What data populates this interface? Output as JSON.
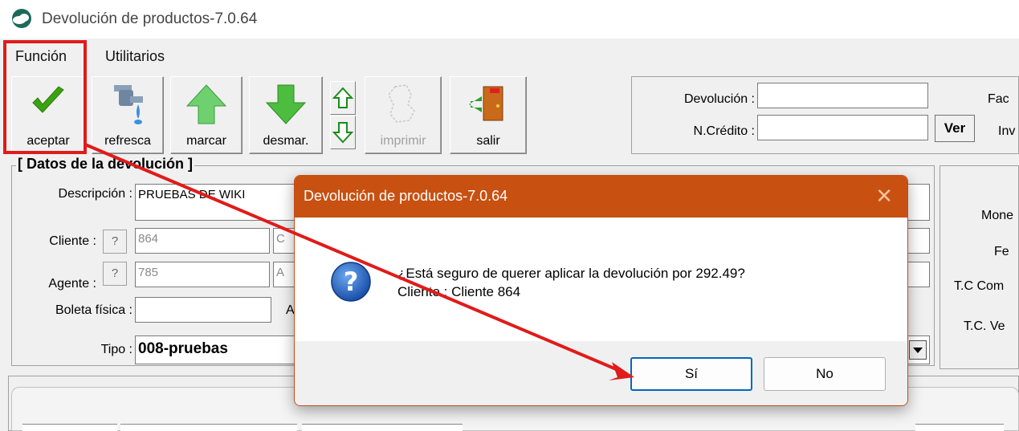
{
  "window": {
    "title": "Devolución de productos-7.0.64"
  },
  "menu": {
    "items": [
      "Función",
      "Utilitarios"
    ]
  },
  "toolbar": {
    "aceptar": "aceptar",
    "refresca": "refresca",
    "marcar": "marcar",
    "desmarcar": "desmar.",
    "imprimir": "imprimir",
    "salir": "salir"
  },
  "search": {
    "devolucion_label": "Devolución :",
    "devolucion_value": "",
    "ncredito_label": "N.Crédito :",
    "ncredito_value": "",
    "ver": "Ver",
    "fac_label": "Fac",
    "inv_label": "Inv"
  },
  "form": {
    "group_title": "[ Datos de la devolución ]",
    "descripcion_label": "Descripción :",
    "descripcion_value": "PRUEBAS DE WIKI",
    "cliente_label": "Cliente :",
    "cliente_value": "864",
    "cliente_name": "C",
    "agente_label": "Agente :",
    "agente_value": "785",
    "agente_name": "A",
    "boleta_label": "Boleta física :",
    "boleta_value": "",
    "boleta_side": "A",
    "tipo_label": "Tipo :",
    "tipo_value": "008-pruebas",
    "question_mark": "?"
  },
  "right_panel": {
    "moneda": "Mone",
    "fecha": "Fe",
    "tc_compra": "T.C Com",
    "tc_venta": "T.C. Ve"
  },
  "dialog": {
    "title": "Devolución de productos-7.0.64",
    "close": "✕",
    "message_line1": "¿Está seguro de querer aplicar la devolución por 292.49?",
    "message_line2": "Cliente : Cliente 864",
    "yes": "Sí",
    "no": "No"
  },
  "colors": {
    "dialog_header": "#c85011",
    "annotation_red": "#e01b1b",
    "focus_blue": "#0067c0"
  }
}
